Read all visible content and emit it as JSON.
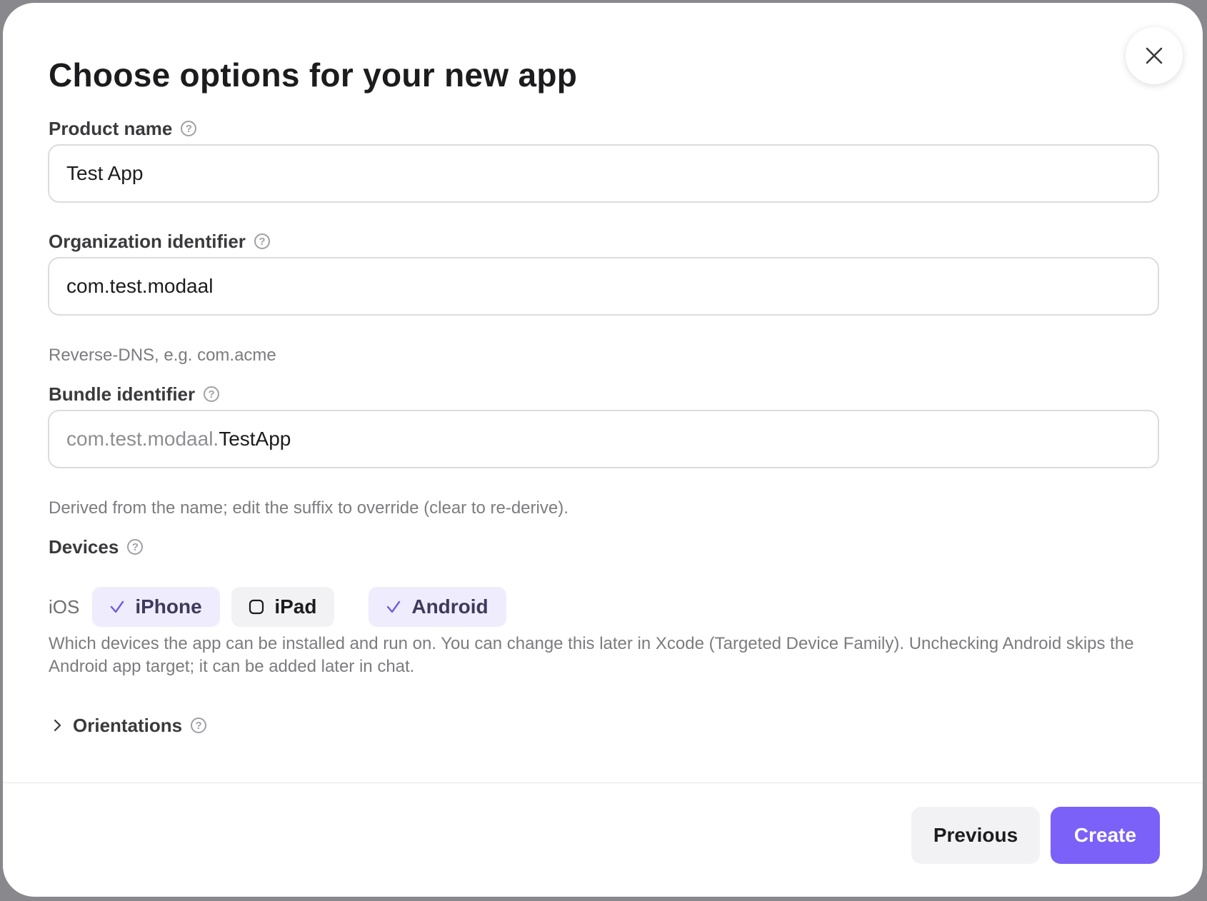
{
  "dialog": {
    "title": "Choose options for your new app",
    "help_glyph": "?"
  },
  "product_name": {
    "label": "Product name",
    "value": "Test App"
  },
  "organization_identifier": {
    "label": "Organization identifier",
    "value": "com.test.modaal",
    "hint": "Reverse-DNS, e.g. com.acme"
  },
  "bundle_identifier": {
    "label": "Bundle identifier",
    "prefix": "com.test.modaal.",
    "suffix": "TestApp",
    "hint": "Derived from the name; edit the suffix to override (clear to re-derive)."
  },
  "devices": {
    "label": "Devices",
    "platform_label": "iOS",
    "options": [
      {
        "label": "iPhone",
        "checked": true
      },
      {
        "label": "iPad",
        "checked": false
      },
      {
        "label": "Android",
        "checked": true
      }
    ],
    "hint": "Which devices the app can be installed and run on. You can change this later in Xcode (Targeted Device Family). Unchecking Android skips the Android app target; it can be added later in chat."
  },
  "orientations": {
    "label": "Orientations",
    "expanded": false
  },
  "footer": {
    "previous_label": "Previous",
    "create_label": "Create"
  },
  "colors": {
    "accent": "#7b61f7",
    "chip_selected_bg": "#efecfd",
    "chip_unselected_bg": "#f2f2f4"
  },
  "icons": {
    "close": "close-icon",
    "help": "help-icon",
    "check": "checkmark-icon",
    "unchecked": "checkbox-empty-icon",
    "expand": "chevron-right-icon"
  }
}
